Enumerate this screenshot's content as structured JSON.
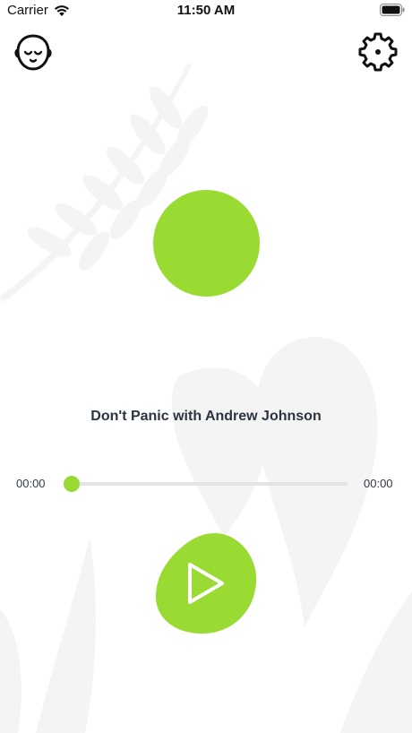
{
  "status_bar": {
    "carrier": "Carrier",
    "time": "11:50 AM",
    "wifi_icon": "wifi-icon",
    "battery_icon": "battery-icon"
  },
  "header": {
    "left_icon": "meditation-face-icon",
    "right_icon": "gear-icon"
  },
  "player": {
    "title": "Don't Panic with Andrew Johnson",
    "elapsed": "00:00",
    "total": "00:00",
    "progress_fraction": 0,
    "play_icon": "play-icon"
  },
  "colors": {
    "accent": "#9adb33",
    "text_dark": "#2b3440",
    "track": "#e1e4e6",
    "leaf": "#f4f5f4"
  }
}
